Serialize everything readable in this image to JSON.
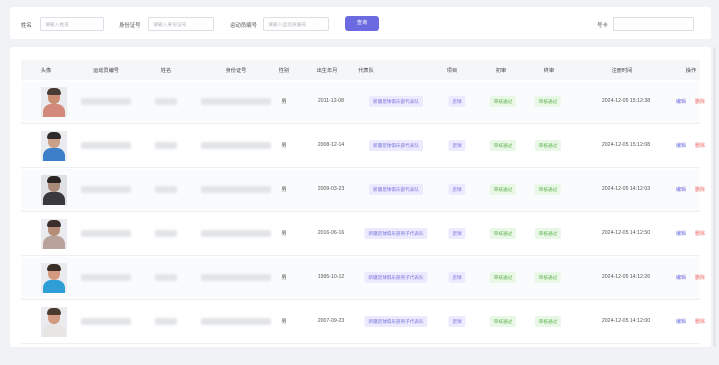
{
  "filters": {
    "name_label": "姓名",
    "name_placeholder": "请输入姓名",
    "id_label": "身份证号",
    "id_placeholder": "请输入身份证号",
    "athlete_label": "运动员编号",
    "athlete_placeholder": "请输入运动员编号",
    "search_button": "查询",
    "card_label": "号卡"
  },
  "table": {
    "headers": [
      "头像",
      "运动员编号",
      "姓名",
      "身份证号",
      "性别",
      "出生年月",
      "代表队",
      "项目",
      "初审",
      "终审",
      "注册时间",
      "操作"
    ],
    "rows": [
      {
        "gender": "男",
        "birth": "2011-12-08",
        "team": "新疆足球俱乐部代表队",
        "item": "足球",
        "first": "审核通过",
        "final": "审核通过",
        "registered": "2024-12-05 15:12:38",
        "edit": "编辑",
        "delete": "删除"
      },
      {
        "gender": "男",
        "birth": "2008-12-14",
        "team": "新疆足球俱乐部代表队",
        "item": "足球",
        "first": "审核通过",
        "final": "审核通过",
        "registered": "2024-12-05 15:12:08",
        "edit": "编辑",
        "delete": "删除"
      },
      {
        "gender": "男",
        "birth": "2009-03-23",
        "team": "新疆足球俱乐部代表队",
        "item": "足球",
        "first": "审核通过",
        "final": "审核通过",
        "registered": "2024-12-05 14:12:03",
        "edit": "编辑",
        "delete": "删除"
      },
      {
        "gender": "男",
        "birth": "2016-06-16",
        "team": "新疆足球俱乐部男子代表队",
        "item": "足球",
        "first": "审核通过",
        "final": "审核通过",
        "registered": "2024-12-05 14:12:50",
        "edit": "编辑",
        "delete": "删除"
      },
      {
        "gender": "男",
        "birth": "1995-10-12",
        "team": "新疆足球俱乐部男子代表队",
        "item": "足球",
        "first": "审核通过",
        "final": "审核通过",
        "registered": "2024-12-05 14:12:26",
        "edit": "编辑",
        "delete": "删除"
      },
      {
        "gender": "男",
        "birth": "2007-09-23",
        "team": "新疆足球俱乐部男子代表队",
        "item": "足球",
        "first": "审核通过",
        "final": "审核通过",
        "registered": "2024-12-05 14:12:00",
        "edit": "编辑",
        "delete": "删除"
      }
    ]
  },
  "colors": {
    "primary": "#6b6ae0",
    "success_text": "#5bb04c",
    "danger_text": "#ef6a6a"
  }
}
